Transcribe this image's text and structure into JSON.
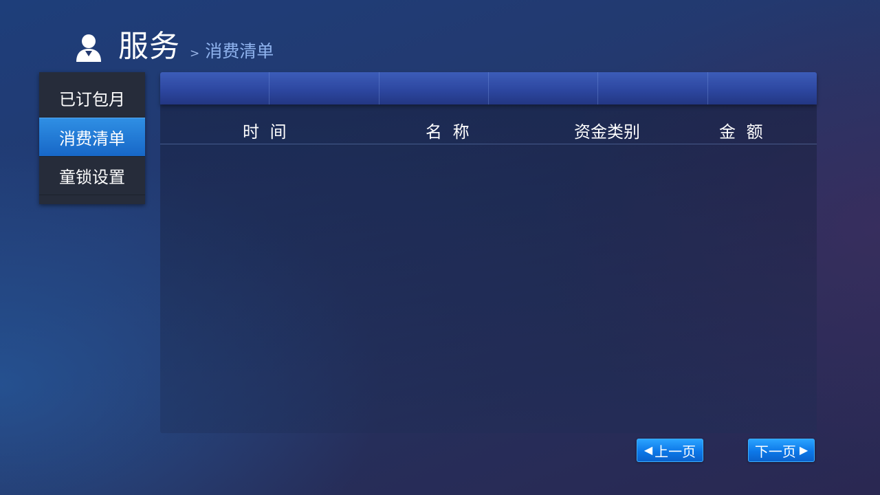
{
  "header": {
    "icon": "user-icon",
    "title": "服务",
    "separator": ">",
    "breadcrumb": "消费清单"
  },
  "sidebar": {
    "items": [
      {
        "label": "已订包月",
        "active": false
      },
      {
        "label": "消费清单",
        "active": true
      },
      {
        "label": "童锁设置",
        "active": false
      }
    ]
  },
  "table": {
    "columns": [
      "时 间",
      "名 称",
      "资金类别",
      "金 额"
    ],
    "rows": []
  },
  "pager": {
    "prev_label": "上一页",
    "next_label": "下一页",
    "prev_icon": "triangle-left-icon",
    "next_icon": "triangle-right-icon"
  },
  "colors": {
    "accent": "#1a6fd6",
    "active_menu": "#2f8fe4",
    "breadcrumb": "#8fb3ee"
  }
}
